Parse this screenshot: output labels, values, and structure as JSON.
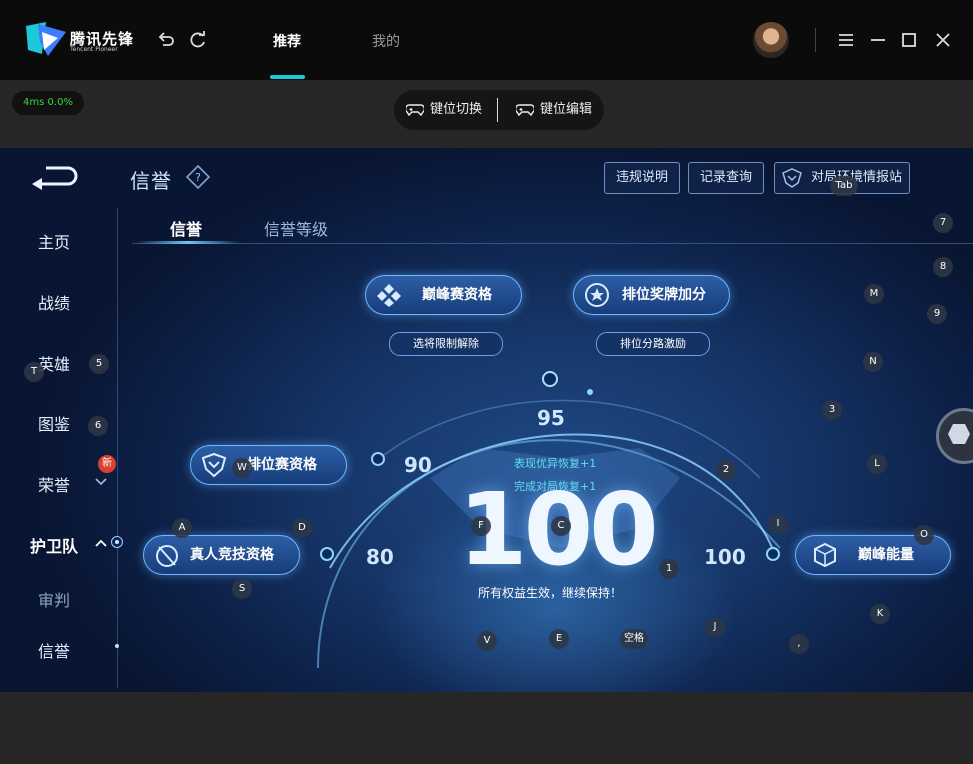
{
  "app": {
    "brand_cn": "腾讯先锋",
    "brand_en": "Tencent Pioneer",
    "tabs": [
      {
        "label": "推荐",
        "active": true
      },
      {
        "label": "我的",
        "active": false
      }
    ],
    "accent": "#1ec8d8"
  },
  "toolbar": {
    "latency": "4ms  0.0%",
    "key_switch": "键位切换",
    "key_edit": "键位编辑"
  },
  "game": {
    "page_title": "信誉",
    "header_buttons": [
      "违规说明",
      "记录查询",
      "对局环境情报站"
    ],
    "sidebar": [
      {
        "label": "主页"
      },
      {
        "label": "战绩"
      },
      {
        "label": "英雄"
      },
      {
        "label": "图鉴"
      },
      {
        "label": "荣誉",
        "badge": "新"
      },
      {
        "label": "护卫队",
        "active": true
      },
      {
        "label": "审判"
      },
      {
        "label": "信誉"
      }
    ],
    "subtabs": [
      {
        "label": "信誉",
        "active": true
      },
      {
        "label": "信誉等级",
        "active": false
      }
    ],
    "qualifications": {
      "peak": "巅峰赛资格",
      "peak_sub": "选将限制解除",
      "rank_bonus": "排位奖牌加分",
      "rank_bonus_sub": "排位分路激励",
      "ranked": "排位赛资格",
      "human_match": "真人竞技资格",
      "peak_energy": "巅峰能量"
    },
    "scores": {
      "current": "100",
      "t80": "80",
      "t90": "90",
      "t95": "95",
      "t100": "100"
    },
    "recover_1": "表现优异恢复+1",
    "recover_2": "完成对局恢复+1",
    "status_msg": "所有权益生效，继续保持！"
  },
  "keymap": {
    "Tab": "Tab",
    "7": "7",
    "8": "8",
    "M": "M",
    "9": "9",
    "T": "T",
    "k5": "5",
    "N": "N",
    "k3": "3",
    "k6": "6",
    "W": "W",
    "k2": "2",
    "L": "L",
    "A": "A",
    "D": "D",
    "F": "F",
    "C": "C",
    "I": "I",
    "O": "O",
    "S": "S",
    "k1": "1",
    "K": "K",
    "J": "J",
    "V": "V",
    "E": "E",
    "space": "空格",
    "comma": ","
  }
}
